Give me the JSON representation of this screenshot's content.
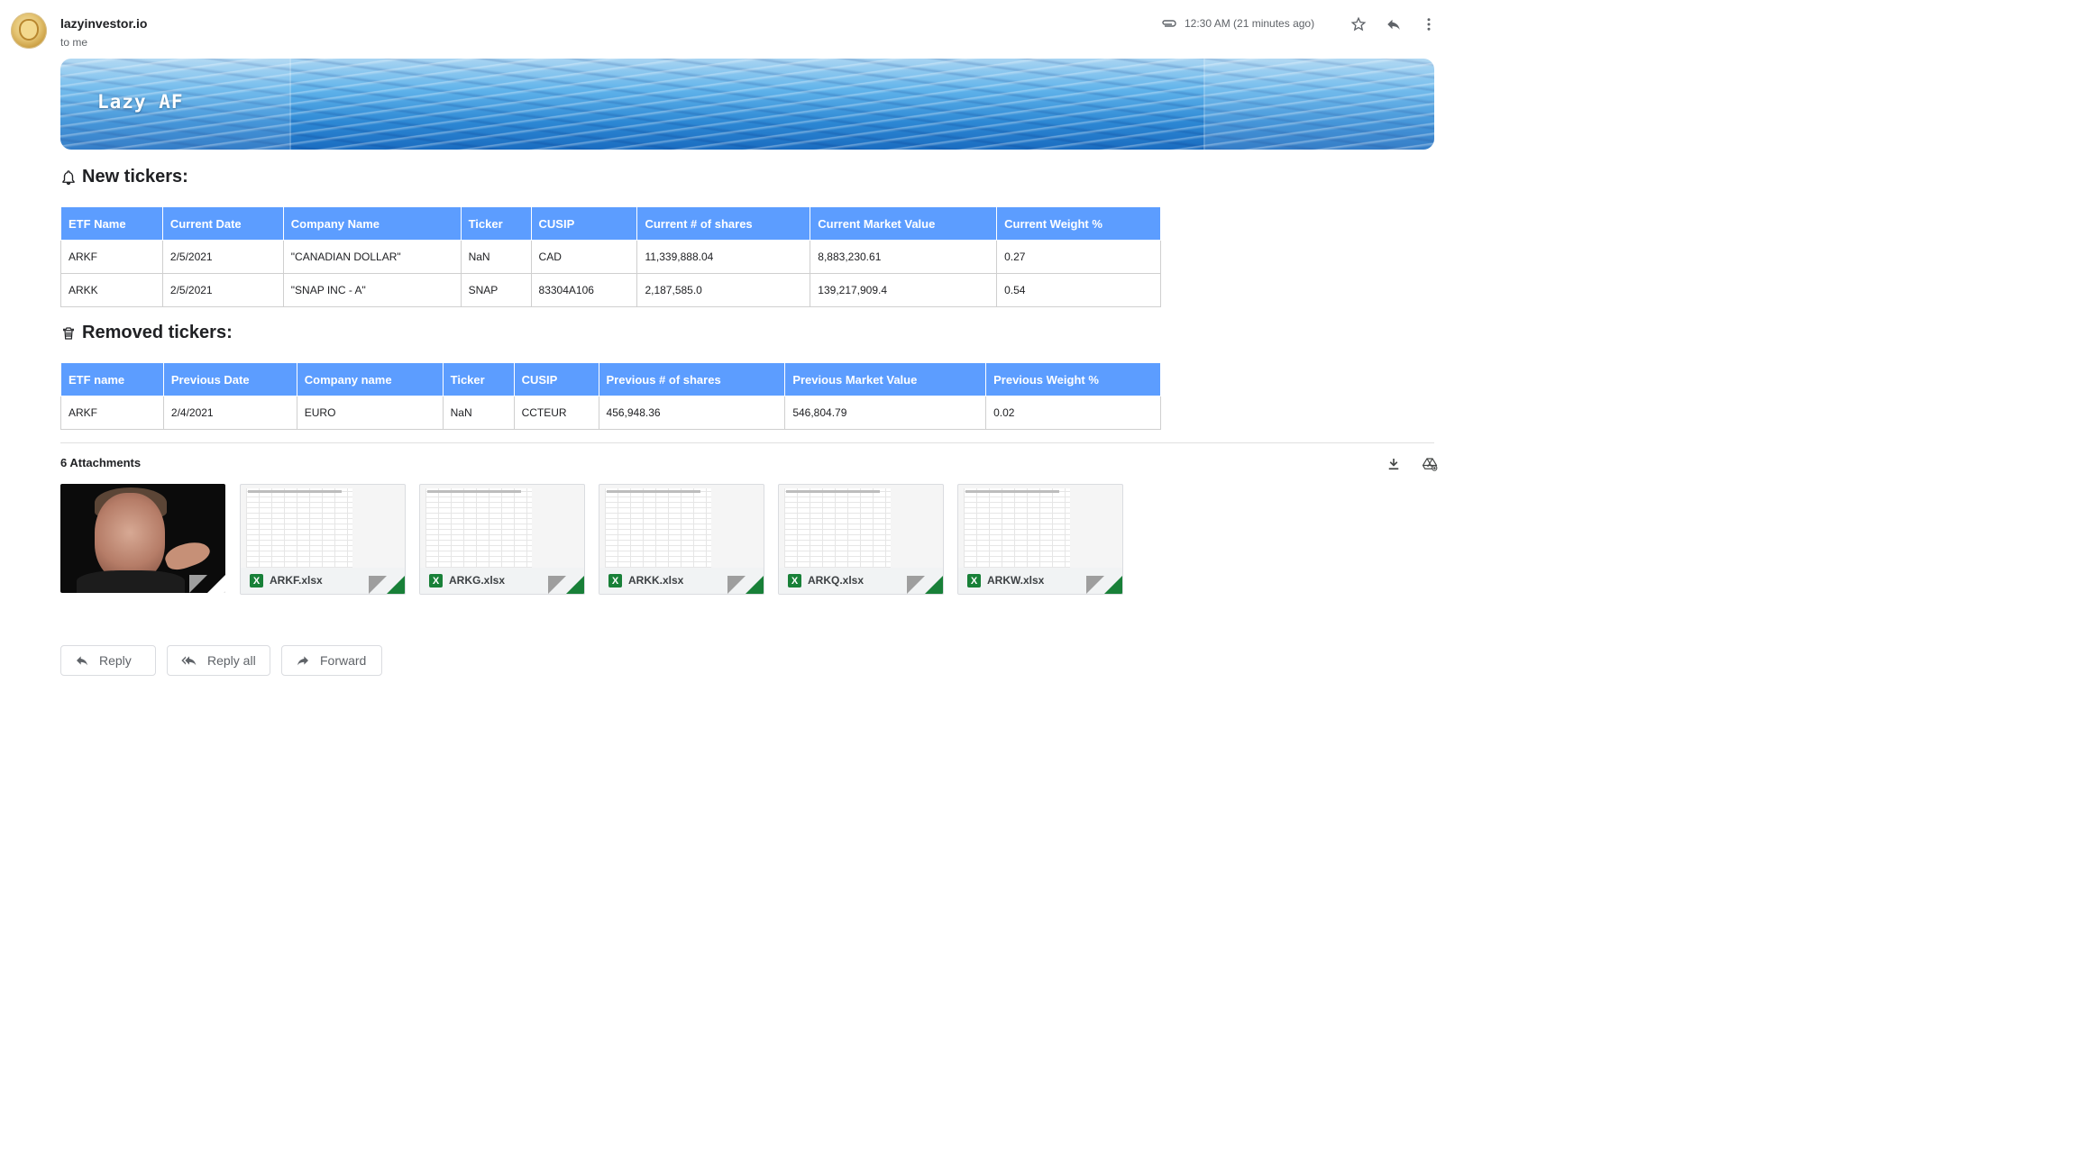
{
  "header": {
    "sender": "lazyinvestor.io",
    "to": "to me",
    "time": "12:30 AM (21 minutes ago)"
  },
  "banner": {
    "title": "Lazy AF"
  },
  "new_tickers": {
    "heading": "New tickers:",
    "columns": [
      "ETF Name",
      "Current Date",
      "Company Name",
      "Ticker",
      "CUSIP",
      "Current # of shares",
      "Current Market Value",
      "Current Weight %"
    ],
    "rows": [
      [
        "ARKF",
        "2/5/2021",
        "\"CANADIAN DOLLAR\"",
        "NaN",
        "CAD",
        "11,339,888.04",
        "8,883,230.61",
        "0.27"
      ],
      [
        "ARKK",
        "2/5/2021",
        "\"SNAP INC - A\"",
        "SNAP",
        "83304A106",
        "2,187,585.0",
        "139,217,909.4",
        "0.54"
      ]
    ]
  },
  "removed_tickers": {
    "heading": "Removed tickers:",
    "columns": [
      "ETF name",
      "Previous Date",
      "Company name",
      "Ticker",
      "CUSIP",
      "Previous # of shares",
      "Previous Market Value",
      "Previous Weight %"
    ],
    "rows": [
      [
        "ARKF",
        "2/4/2021",
        "EURO",
        "NaN",
        "CCTEUR",
        "456,948.36",
        "546,804.79",
        "0.02"
      ]
    ]
  },
  "attachments": {
    "heading": "6 Attachments",
    "files": [
      {
        "name": "ARKF.xlsx"
      },
      {
        "name": "ARKG.xlsx"
      },
      {
        "name": "ARKK.xlsx"
      },
      {
        "name": "ARKQ.xlsx"
      },
      {
        "name": "ARKW.xlsx"
      }
    ]
  },
  "actions": {
    "reply": "Reply",
    "reply_all": "Reply all",
    "forward": "Forward"
  },
  "colors": {
    "table_header": "#5c9dff",
    "excel_green": "#188038"
  }
}
